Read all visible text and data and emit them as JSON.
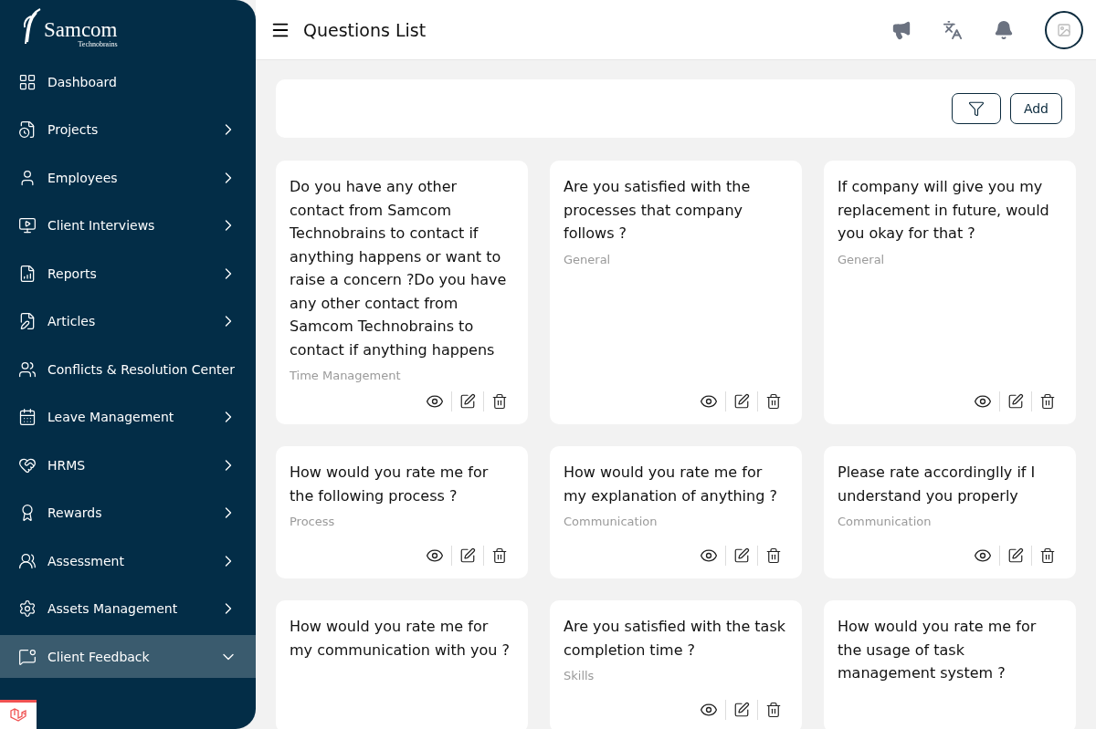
{
  "sidebar": {
    "logo": {
      "name": "Samcom",
      "tagline": "Technobrains"
    },
    "items": [
      {
        "label": "Dashboard",
        "kind": "link",
        "selected": false
      },
      {
        "label": "Projects",
        "kind": "group",
        "selected": false,
        "expanded": false
      },
      {
        "label": "Employees",
        "kind": "group",
        "selected": false,
        "expanded": false
      },
      {
        "label": "Client Interviews",
        "kind": "group",
        "selected": false,
        "expanded": false
      },
      {
        "label": "Reports",
        "kind": "group",
        "selected": false,
        "expanded": false
      },
      {
        "label": "Articles",
        "kind": "group",
        "selected": false,
        "expanded": false
      },
      {
        "label": "Conflicts & Resolution Center",
        "kind": "link",
        "selected": false
      },
      {
        "label": "Leave Management",
        "kind": "group",
        "selected": false,
        "expanded": false
      },
      {
        "label": "HRMS",
        "kind": "group",
        "selected": false,
        "expanded": false
      },
      {
        "label": "Rewards",
        "kind": "group",
        "selected": false,
        "expanded": false
      },
      {
        "label": "Assessment",
        "kind": "group",
        "selected": false,
        "expanded": false
      },
      {
        "label": "Assets Management",
        "kind": "group",
        "selected": false,
        "expanded": false
      },
      {
        "label": "Client Feedback",
        "kind": "group",
        "selected": true,
        "expanded": true
      }
    ]
  },
  "header": {
    "title": "Questions List"
  },
  "toolbar": {
    "add_button": "Add"
  },
  "questions": [
    {
      "text": "Do you have any other contact from Samcom Technobrains to contact if anything happens or want to raise a concern ?Do you have any other contact from Samcom Technobrains to contact if anything happens",
      "category": "Time Management"
    },
    {
      "text": "Are you satisfied with the processes that company follows ?",
      "category": "General"
    },
    {
      "text": "If company will give you my replacement in future, would you okay for that ?",
      "category": "General"
    },
    {
      "text": "How would you rate me for the following process ?",
      "category": "Process"
    },
    {
      "text": "How would you rate me for my explanation of anything ?",
      "category": "Communication"
    },
    {
      "text": "Please rate accordinglly if I understand you properly",
      "category": "Communication"
    },
    {
      "text": "How would you rate me for my communication with you ?"
    },
    {
      "text": "Are you satisfied with the task completion time ?",
      "category": "Skills"
    },
    {
      "text": "How would you rate me for the usage of task management system ?"
    }
  ]
}
